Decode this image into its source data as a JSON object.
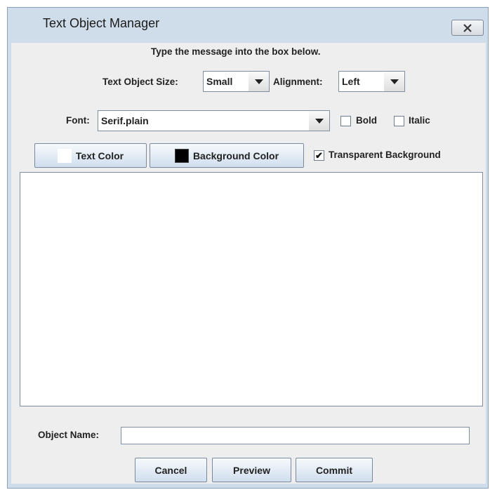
{
  "window": {
    "title": "Text Object Manager",
    "close_icon": "close-x-icon"
  },
  "instructions": "Type the message into the box below.",
  "size": {
    "label": "Text Object Size:",
    "value": "Small"
  },
  "alignment": {
    "label": "Alignment:",
    "value": "Left"
  },
  "font": {
    "label": "Font:",
    "value": "Serif.plain"
  },
  "bold": {
    "label": "Bold",
    "checked": false
  },
  "italic": {
    "label": "Italic",
    "checked": false
  },
  "text_color": {
    "label": "Text Color",
    "swatch": "#ffffff"
  },
  "background_color": {
    "label": "Background Color",
    "swatch": "#000000"
  },
  "transparent": {
    "label": "Transparent Background",
    "checked": true,
    "mark": "✔"
  },
  "message_text": "",
  "object_name": {
    "label": "Object Name:",
    "value": ""
  },
  "buttons": {
    "cancel": "Cancel",
    "preview": "Preview",
    "commit": "Commit"
  }
}
